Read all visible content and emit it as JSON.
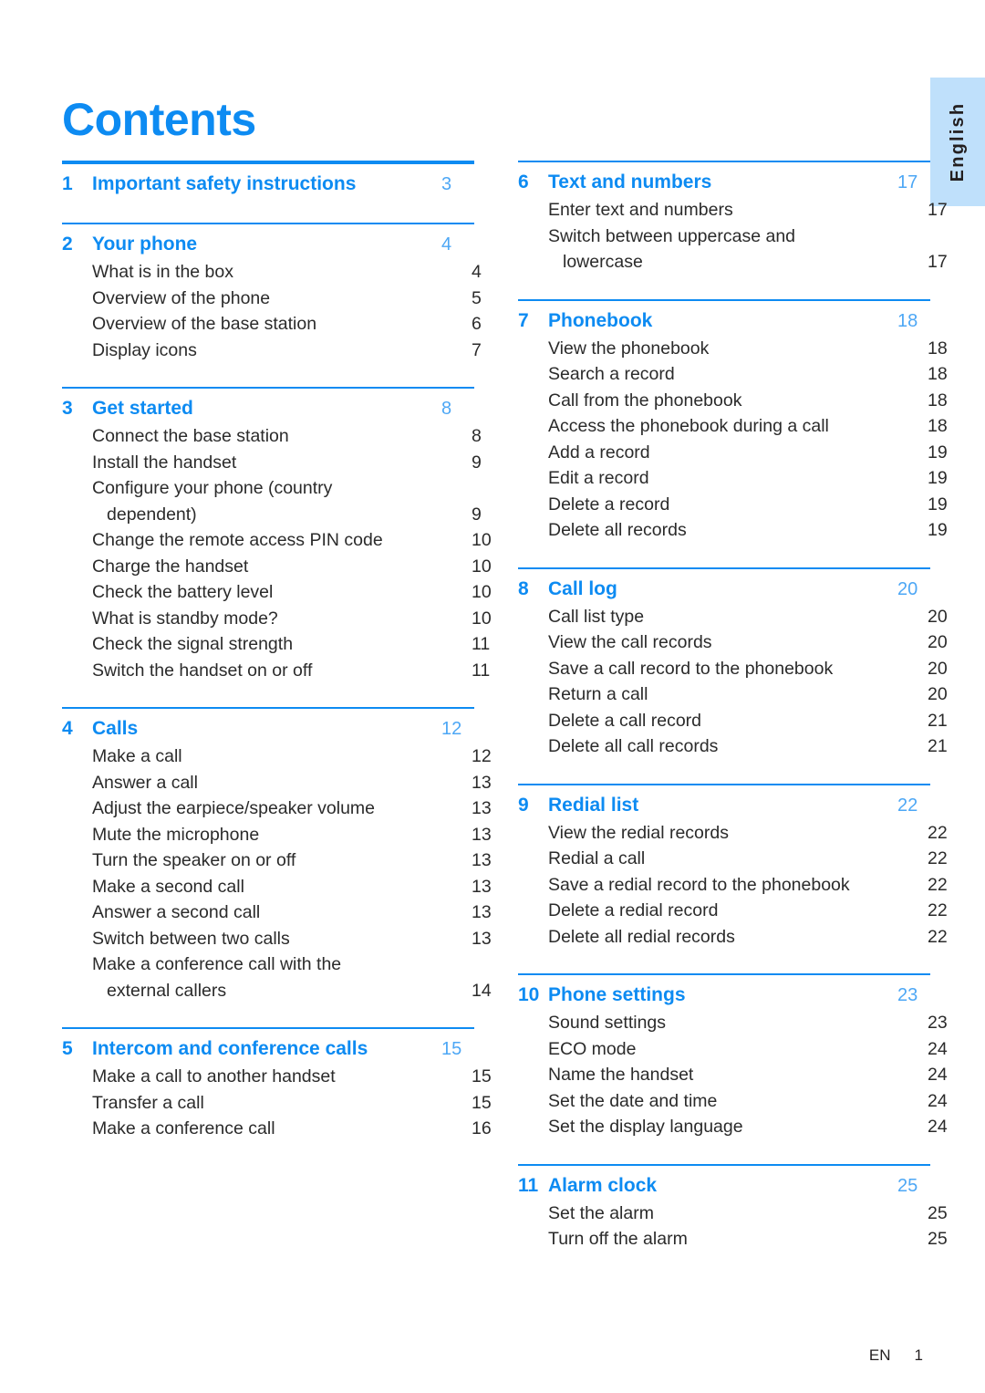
{
  "page_title": "Contents",
  "language_tab": {
    "label": "English"
  },
  "footer": {
    "locale": "EN",
    "page_number": "1"
  },
  "colors": {
    "accent_blue": "#0d8bf2",
    "page_number_blue": "#4da7f5",
    "tab_background": "#bfe0fb",
    "body_text": "#2b2b2b"
  },
  "columns": [
    {
      "id": "left",
      "sections": [
        {
          "number": "1",
          "title": "Important safety instructions",
          "page": "3",
          "rule": "thick",
          "entries": []
        },
        {
          "number": "2",
          "title": "Your phone",
          "page": "4",
          "rule": "thin",
          "entries": [
            {
              "label": "What is in the box",
              "page": "4"
            },
            {
              "label": "Overview of the phone",
              "page": "5"
            },
            {
              "label": "Overview of the base station",
              "page": "6"
            },
            {
              "label": "Display icons",
              "page": "7"
            }
          ]
        },
        {
          "number": "3",
          "title": "Get started",
          "page": "8",
          "rule": "thin",
          "entries": [
            {
              "label": "Connect the base station",
              "page": "8"
            },
            {
              "label": "Install the handset",
              "page": "9"
            },
            {
              "label": "Configure your phone (country",
              "continuation": "dependent)",
              "page": "9"
            },
            {
              "label": "Change the remote access PIN code",
              "page": "10"
            },
            {
              "label": "Charge the handset",
              "page": "10"
            },
            {
              "label": "Check the battery level",
              "page": "10"
            },
            {
              "label": "What is standby mode?",
              "page": "10"
            },
            {
              "label": "Check the signal strength",
              "page": "11"
            },
            {
              "label": "Switch the handset on or off",
              "page": "11"
            }
          ]
        },
        {
          "number": "4",
          "title": "Calls",
          "page": "12",
          "rule": "thin",
          "entries": [
            {
              "label": "Make a call",
              "page": "12"
            },
            {
              "label": "Answer a call",
              "page": "13"
            },
            {
              "label": "Adjust the earpiece/speaker volume",
              "page": "13"
            },
            {
              "label": "Mute the microphone",
              "page": "13"
            },
            {
              "label": "Turn the speaker on or off",
              "page": "13"
            },
            {
              "label": "Make a second call",
              "page": "13"
            },
            {
              "label": "Answer a second call",
              "page": "13"
            },
            {
              "label": "Switch between two calls",
              "page": "13"
            },
            {
              "label": "Make a conference call with the",
              "continuation": "external callers",
              "page": "14"
            }
          ]
        },
        {
          "number": "5",
          "title": "Intercom and conference calls",
          "page": "15",
          "rule": "thin",
          "entries": [
            {
              "label": "Make a call to another handset",
              "page": "15"
            },
            {
              "label": "Transfer a call",
              "page": "15"
            },
            {
              "label": "Make a conference call",
              "page": "16"
            }
          ]
        }
      ]
    },
    {
      "id": "right",
      "sections": [
        {
          "number": "6",
          "title": "Text and numbers",
          "page": "17",
          "rule": "thin",
          "entries": [
            {
              "label": "Enter text and numbers",
              "page": "17"
            },
            {
              "label": "Switch between uppercase and",
              "continuation": "lowercase",
              "page": "17"
            }
          ]
        },
        {
          "number": "7",
          "title": "Phonebook",
          "page": "18",
          "rule": "thin",
          "entries": [
            {
              "label": "View the phonebook",
              "page": "18"
            },
            {
              "label": "Search a record",
              "page": "18"
            },
            {
              "label": "Call from the phonebook",
              "page": "18"
            },
            {
              "label": "Access the phonebook during a call",
              "page": "18"
            },
            {
              "label": "Add a record",
              "page": "19"
            },
            {
              "label": "Edit a record",
              "page": "19"
            },
            {
              "label": "Delete a record",
              "page": "19"
            },
            {
              "label": "Delete all records",
              "page": "19"
            }
          ]
        },
        {
          "number": "8",
          "title": "Call log",
          "page": "20",
          "rule": "thin",
          "entries": [
            {
              "label": "Call list type",
              "page": "20"
            },
            {
              "label": "View the call records",
              "page": "20"
            },
            {
              "label": "Save a call record to the phonebook",
              "page": "20"
            },
            {
              "label": "Return a call",
              "page": "20"
            },
            {
              "label": "Delete a call record",
              "page": "21"
            },
            {
              "label": "Delete all call records",
              "page": "21"
            }
          ]
        },
        {
          "number": "9",
          "title": "Redial list",
          "page": "22",
          "rule": "thin",
          "entries": [
            {
              "label": "View the redial records",
              "page": "22"
            },
            {
              "label": "Redial a call",
              "page": "22"
            },
            {
              "label": "Save a redial record to the phonebook",
              "page": "22"
            },
            {
              "label": "Delete a redial record",
              "page": "22"
            },
            {
              "label": "Delete all redial records",
              "page": "22"
            }
          ]
        },
        {
          "number": "10",
          "title": "Phone settings",
          "page": "23",
          "rule": "thin",
          "entries": [
            {
              "label": "Sound settings",
              "page": "23"
            },
            {
              "label": "ECO mode",
              "page": "24"
            },
            {
              "label": "Name the handset",
              "page": "24"
            },
            {
              "label": "Set the date and time",
              "page": "24"
            },
            {
              "label": "Set the display language",
              "page": "24"
            }
          ]
        },
        {
          "number": "11",
          "title": "Alarm clock",
          "page": "25",
          "rule": "thin",
          "entries": [
            {
              "label": "Set the alarm",
              "page": "25"
            },
            {
              "label": "Turn off the alarm",
              "page": "25"
            }
          ]
        }
      ]
    }
  ]
}
